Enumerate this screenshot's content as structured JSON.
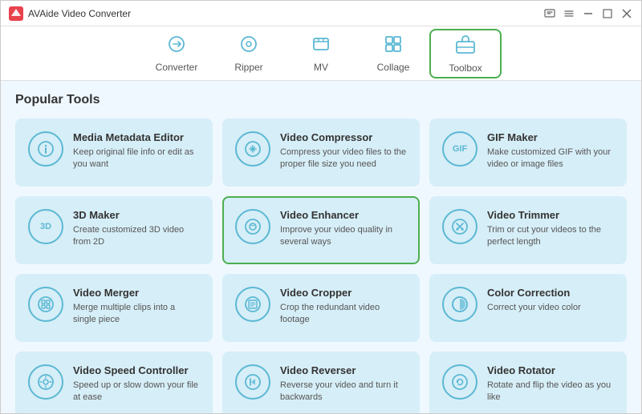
{
  "titleBar": {
    "appName": "AVAide Video Converter",
    "controls": [
      "minimize",
      "maximize",
      "close"
    ]
  },
  "nav": {
    "items": [
      {
        "id": "converter",
        "label": "Converter",
        "icon": "⟳",
        "active": false
      },
      {
        "id": "ripper",
        "label": "Ripper",
        "icon": "⊙",
        "active": false
      },
      {
        "id": "mv",
        "label": "MV",
        "icon": "🖼",
        "active": false
      },
      {
        "id": "collage",
        "label": "Collage",
        "icon": "⊞",
        "active": false
      },
      {
        "id": "toolbox",
        "label": "Toolbox",
        "icon": "🧰",
        "active": true
      }
    ]
  },
  "main": {
    "sectionTitle": "Popular Tools",
    "tools": [
      {
        "id": "media-metadata",
        "name": "Media Metadata Editor",
        "desc": "Keep original file info or edit as you want",
        "icon": "ℹ",
        "highlighted": false
      },
      {
        "id": "video-compressor",
        "name": "Video Compressor",
        "desc": "Compress your video files to the proper file size you need",
        "icon": "⊛",
        "highlighted": false
      },
      {
        "id": "gif-maker",
        "name": "GIF Maker",
        "desc": "Make customized GIF with your video or image files",
        "icon": "GIF",
        "highlighted": false
      },
      {
        "id": "3d-maker",
        "name": "3D Maker",
        "desc": "Create customized 3D video from 2D",
        "icon": "3D",
        "highlighted": false
      },
      {
        "id": "video-enhancer",
        "name": "Video Enhancer",
        "desc": "Improve your video quality in several ways",
        "icon": "✦",
        "highlighted": true
      },
      {
        "id": "video-trimmer",
        "name": "Video Trimmer",
        "desc": "Trim or cut your videos to the perfect length",
        "icon": "✂",
        "highlighted": false
      },
      {
        "id": "video-merger",
        "name": "Video Merger",
        "desc": "Merge multiple clips into a single piece",
        "icon": "⊞",
        "highlighted": false
      },
      {
        "id": "video-cropper",
        "name": "Video Cropper",
        "desc": "Crop the redundant video footage",
        "icon": "⊡",
        "highlighted": false
      },
      {
        "id": "color-correction",
        "name": "Color Correction",
        "desc": "Correct your video color",
        "icon": "◑",
        "highlighted": false
      },
      {
        "id": "video-speed-controller",
        "name": "Video Speed Controller",
        "desc": "Speed up or slow down your file at ease",
        "icon": "⊙",
        "highlighted": false
      },
      {
        "id": "video-reverser",
        "name": "Video Reverser",
        "desc": "Reverse your video and turn it backwards",
        "icon": "⏮",
        "highlighted": false
      },
      {
        "id": "video-rotator",
        "name": "Video Rotator",
        "desc": "Rotate and flip the video as you like",
        "icon": "↺",
        "highlighted": false
      }
    ]
  }
}
